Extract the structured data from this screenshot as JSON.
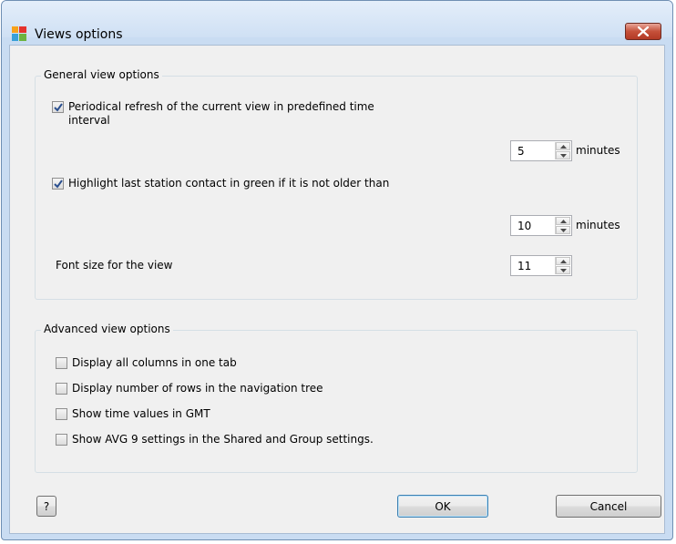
{
  "window": {
    "title": "Views options",
    "icons": {
      "app": "avg-app-icon",
      "close": "close-icon"
    },
    "accent_colors": {
      "close_button": "#c5503a",
      "checkmark": "#2a4f8f"
    }
  },
  "general": {
    "group_title": "General view options",
    "periodical_refresh": {
      "label_line1": "Periodical refresh of the current view in predefined time",
      "label_line2": "interval",
      "checked": true,
      "value": "5",
      "unit": "minutes"
    },
    "highlight_contact": {
      "label": "Highlight last station contact in green if it is not older than",
      "checked": true,
      "value": "10",
      "unit": "minutes"
    },
    "font_size": {
      "label": "Font size for the view",
      "value": "11"
    }
  },
  "advanced": {
    "group_title": "Advanced view options",
    "options": [
      {
        "label": "Display all columns in one tab",
        "checked": false
      },
      {
        "label": "Display number of rows in the navigation tree",
        "checked": false
      },
      {
        "label": "Show time values in GMT",
        "checked": false
      },
      {
        "label": "Show AVG 9 settings in the Shared and Group settings.",
        "checked": false
      }
    ]
  },
  "buttons": {
    "help": "?",
    "ok": "OK",
    "cancel": "Cancel"
  }
}
